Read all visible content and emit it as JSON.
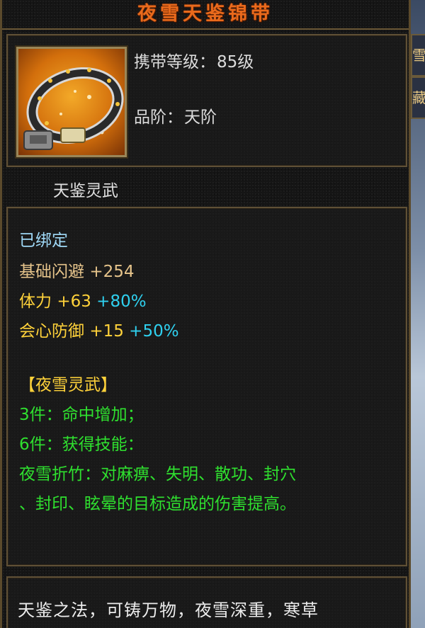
{
  "item": {
    "name": "夜雪天鉴锦带",
    "carry_level_label": "携带等级：",
    "carry_level_value": "85级",
    "grade_label": "品阶：",
    "grade_value": "天阶",
    "set_name": "天鉴灵武",
    "icon": "belt-icon"
  },
  "stats": {
    "bound": "已绑定",
    "lines": [
      {
        "name": "基础闪避",
        "value": "+254",
        "bonus": ""
      },
      {
        "name": "体力",
        "value": "+63",
        "bonus": "+80%"
      },
      {
        "name": "会心防御",
        "value": "+15",
        "bonus": "+50%"
      }
    ]
  },
  "set_bonus": {
    "title": "【夜雪灵武】",
    "piece3": "3件：命中增加；",
    "piece6": "6件：获得技能：",
    "skill_line1": "夜雪折竹：对麻痹、失明、散功、封穴",
    "skill_line2": "、封印、眩晕的目标造成的伤害提高。"
  },
  "description": {
    "line1": "天鉴之法，可铸万物，夜雪深重，寒草"
  },
  "side_tabs": {
    "tab1": "雪",
    "tab2": "藏"
  },
  "colors": {
    "title": "#e96a1c",
    "bound": "#9fd8f6",
    "stat": "#e6c48b",
    "stat_yellow": "#ffd23a",
    "bonus": "#2fd1f0",
    "set": "#2fe02f",
    "border": "#5f5036"
  }
}
